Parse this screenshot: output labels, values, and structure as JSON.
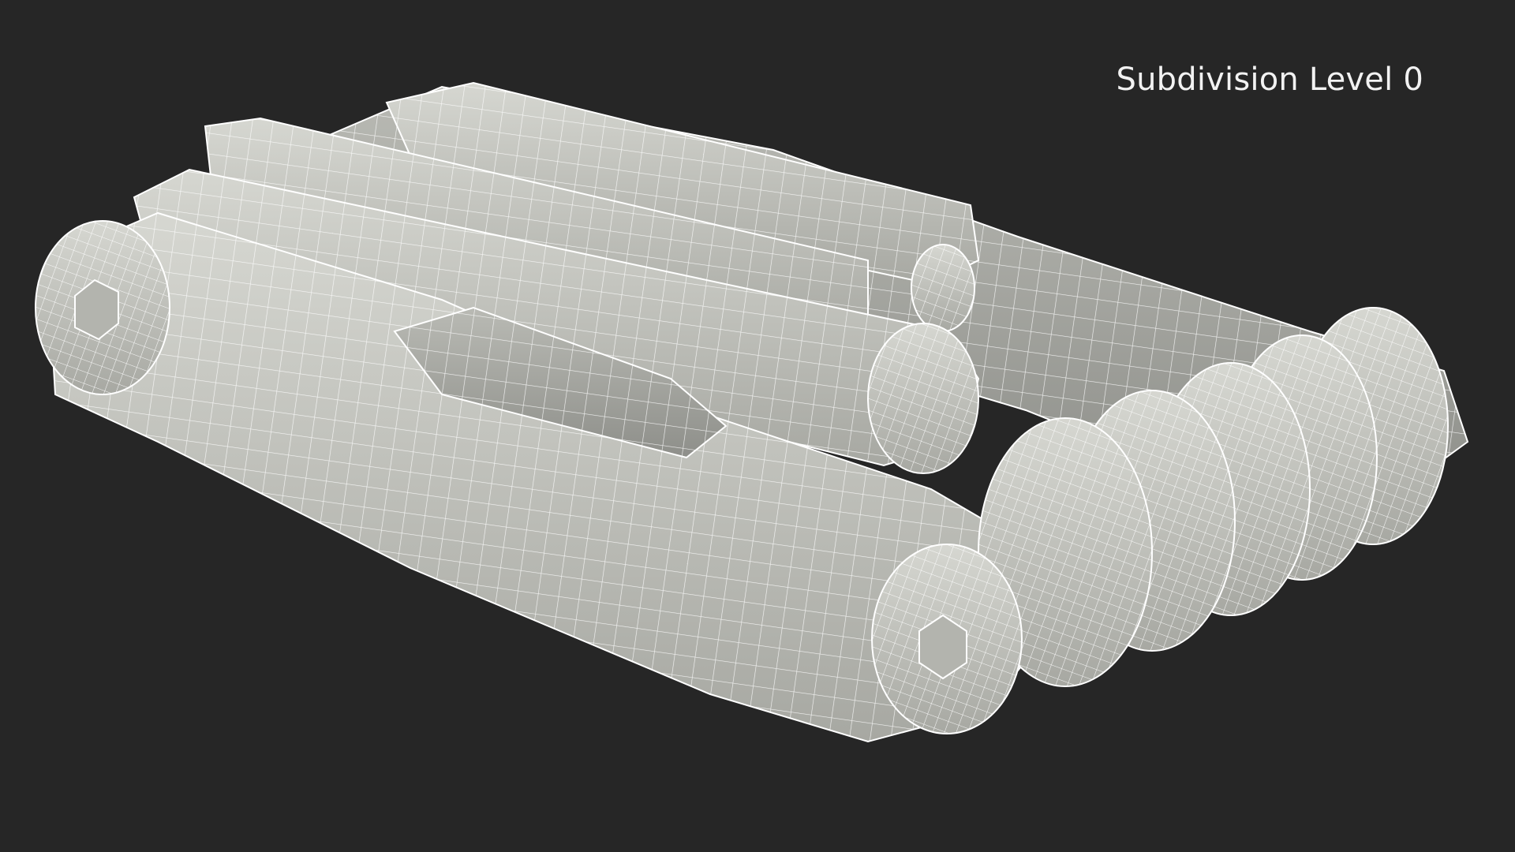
{
  "overlay": {
    "label": "Subdivision Level 0"
  },
  "render": {
    "subject": "multi-tool-wireframe-render",
    "background_color": "#262626",
    "mesh_fill": "#c9cac4",
    "mesh_shadow": "#a9aaa4",
    "wire_color": "#ffffff"
  }
}
